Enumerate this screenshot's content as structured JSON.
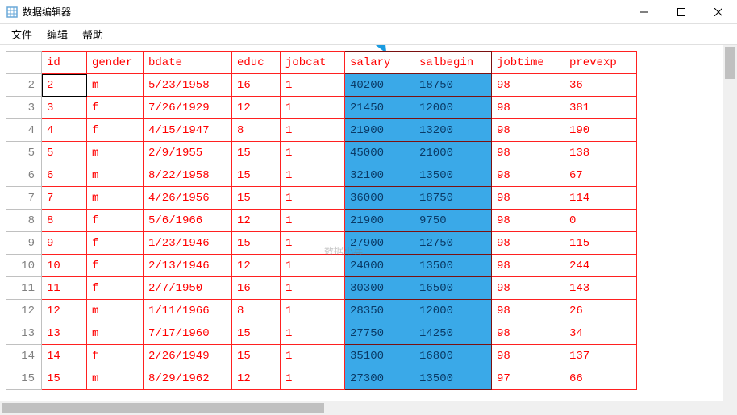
{
  "window": {
    "title": "数据编辑器"
  },
  "menu": {
    "file": "文件",
    "edit": "编辑",
    "help": "帮助"
  },
  "watermark": "数据小兵",
  "columns": [
    "id",
    "gender",
    "bdate",
    "educ",
    "jobcat",
    "salary",
    "salbegin",
    "jobtime",
    "prevexp"
  ],
  "selected_columns": [
    "salary",
    "salbegin"
  ],
  "active_cell": {
    "row": 2,
    "col": "id"
  },
  "rows": [
    {
      "n": 2,
      "id": "2",
      "gender": "m",
      "bdate": "5/23/1958",
      "educ": "16",
      "jobcat": "1",
      "salary": "40200",
      "salbegin": "18750",
      "jobtime": "98",
      "prevexp": "36"
    },
    {
      "n": 3,
      "id": "3",
      "gender": "f",
      "bdate": "7/26/1929",
      "educ": "12",
      "jobcat": "1",
      "salary": "21450",
      "salbegin": "12000",
      "jobtime": "98",
      "prevexp": "381"
    },
    {
      "n": 4,
      "id": "4",
      "gender": "f",
      "bdate": "4/15/1947",
      "educ": "8",
      "jobcat": "1",
      "salary": "21900",
      "salbegin": "13200",
      "jobtime": "98",
      "prevexp": "190"
    },
    {
      "n": 5,
      "id": "5",
      "gender": "m",
      "bdate": "2/9/1955",
      "educ": "15",
      "jobcat": "1",
      "salary": "45000",
      "salbegin": "21000",
      "jobtime": "98",
      "prevexp": "138"
    },
    {
      "n": 6,
      "id": "6",
      "gender": "m",
      "bdate": "8/22/1958",
      "educ": "15",
      "jobcat": "1",
      "salary": "32100",
      "salbegin": "13500",
      "jobtime": "98",
      "prevexp": "67"
    },
    {
      "n": 7,
      "id": "7",
      "gender": "m",
      "bdate": "4/26/1956",
      "educ": "15",
      "jobcat": "1",
      "salary": "36000",
      "salbegin": "18750",
      "jobtime": "98",
      "prevexp": "114"
    },
    {
      "n": 8,
      "id": "8",
      "gender": "f",
      "bdate": "5/6/1966",
      "educ": "12",
      "jobcat": "1",
      "salary": "21900",
      "salbegin": "9750",
      "jobtime": "98",
      "prevexp": "0"
    },
    {
      "n": 9,
      "id": "9",
      "gender": "f",
      "bdate": "1/23/1946",
      "educ": "15",
      "jobcat": "1",
      "salary": "27900",
      "salbegin": "12750",
      "jobtime": "98",
      "prevexp": "115"
    },
    {
      "n": 10,
      "id": "10",
      "gender": "f",
      "bdate": "2/13/1946",
      "educ": "12",
      "jobcat": "1",
      "salary": "24000",
      "salbegin": "13500",
      "jobtime": "98",
      "prevexp": "244"
    },
    {
      "n": 11,
      "id": "11",
      "gender": "f",
      "bdate": "2/7/1950",
      "educ": "16",
      "jobcat": "1",
      "salary": "30300",
      "salbegin": "16500",
      "jobtime": "98",
      "prevexp": "143"
    },
    {
      "n": 12,
      "id": "12",
      "gender": "m",
      "bdate": "1/11/1966",
      "educ": "8",
      "jobcat": "1",
      "salary": "28350",
      "salbegin": "12000",
      "jobtime": "98",
      "prevexp": "26"
    },
    {
      "n": 13,
      "id": "13",
      "gender": "m",
      "bdate": "7/17/1960",
      "educ": "15",
      "jobcat": "1",
      "salary": "27750",
      "salbegin": "14250",
      "jobtime": "98",
      "prevexp": "34"
    },
    {
      "n": 14,
      "id": "14",
      "gender": "f",
      "bdate": "2/26/1949",
      "educ": "15",
      "jobcat": "1",
      "salary": "35100",
      "salbegin": "16800",
      "jobtime": "98",
      "prevexp": "137"
    },
    {
      "n": 15,
      "id": "15",
      "gender": "m",
      "bdate": "8/29/1962",
      "educ": "12",
      "jobcat": "1",
      "salary": "27300",
      "salbegin": "13500",
      "jobtime": "97",
      "prevexp": "66"
    }
  ]
}
